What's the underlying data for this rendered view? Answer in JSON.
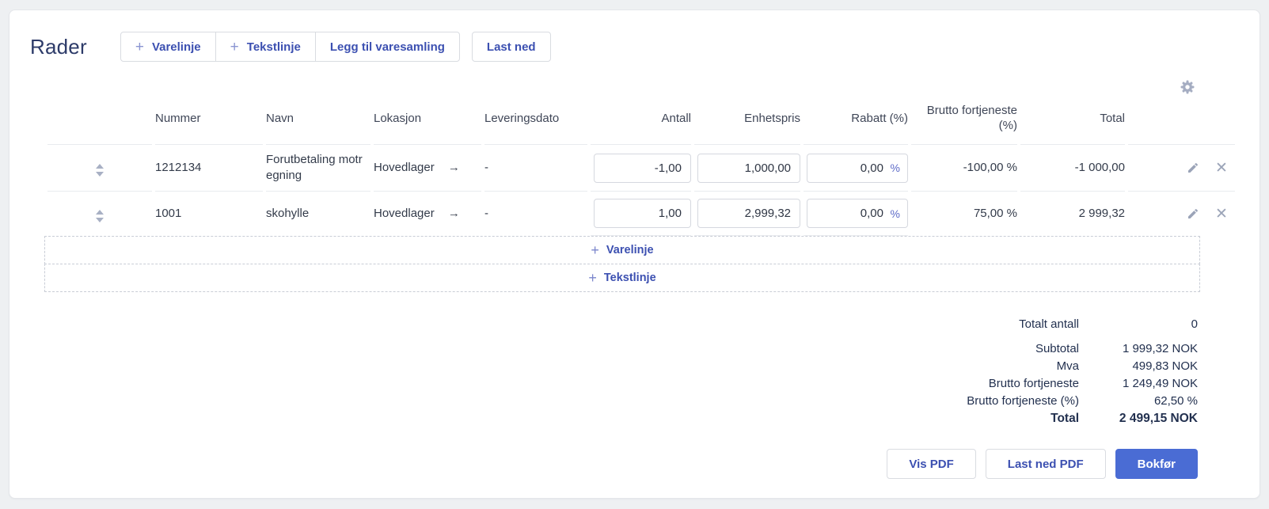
{
  "page": {
    "title": "Rader"
  },
  "toolbar": {
    "group_buttons": [
      {
        "icon": "plus",
        "label": "Varelinje"
      },
      {
        "icon": "plus",
        "label": "Tekstlinje"
      },
      {
        "label": "Legg til varesamling"
      }
    ],
    "download_label": "Last ned"
  },
  "icons": {
    "plus": "+",
    "arrow_right": "→",
    "close": "✕"
  },
  "table": {
    "columns": {
      "nummer": "Nummer",
      "navn": "Navn",
      "lokasjon": "Lokasjon",
      "leveringsdato": "Leveringsdato",
      "antall": "Antall",
      "enhetspris": "Enhetspris",
      "rabatt": "Rabatt (%)",
      "brutto": "Brutto fortjeneste (%)",
      "total": "Total"
    },
    "percent_suffix": "%",
    "rows": [
      {
        "nummer": "1212134",
        "navn": "Forutbetaling motregning",
        "lokasjon": "Hovedlager",
        "leveringsdato": "-",
        "antall": "-1,00",
        "enhetspris": "1,000,00",
        "rabatt": "0,00",
        "brutto": "-100,00 %",
        "total": "-1 000,00"
      },
      {
        "nummer": "1001",
        "navn": "skohylle",
        "lokasjon": "Hovedlager",
        "leveringsdato": "-",
        "antall": "1,00",
        "enhetspris": "2,999,32",
        "rabatt": "0,00",
        "brutto": "75,00 %",
        "total": "2 999,32"
      }
    ],
    "add_lines": {
      "varelinje": "Varelinje",
      "tekstlinje": "Tekstlinje"
    }
  },
  "totals": {
    "rows": [
      {
        "label": "Totalt antall",
        "value": "0"
      },
      {
        "label": "Subtotal",
        "value": "1 999,32 NOK"
      },
      {
        "label": "Mva",
        "value": "499,83 NOK"
      },
      {
        "label": "Brutto fortjeneste",
        "value": "1 249,49 NOK"
      },
      {
        "label": "Brutto fortjeneste (%)",
        "value": "62,50 %"
      },
      {
        "label": "Total",
        "value": "2 499,15 NOK"
      }
    ]
  },
  "footer": {
    "vis_pdf": "Vis PDF",
    "last_ned_pdf": "Last ned PDF",
    "bokfor": "Bokfør"
  },
  "colors": {
    "accent_blue": "#3c50b1",
    "primary_button": "#4a6cd4",
    "title_navy": "#2d3b69",
    "muted_icon": "#a5adc2",
    "percent_suffix": "#5e6bc8"
  }
}
